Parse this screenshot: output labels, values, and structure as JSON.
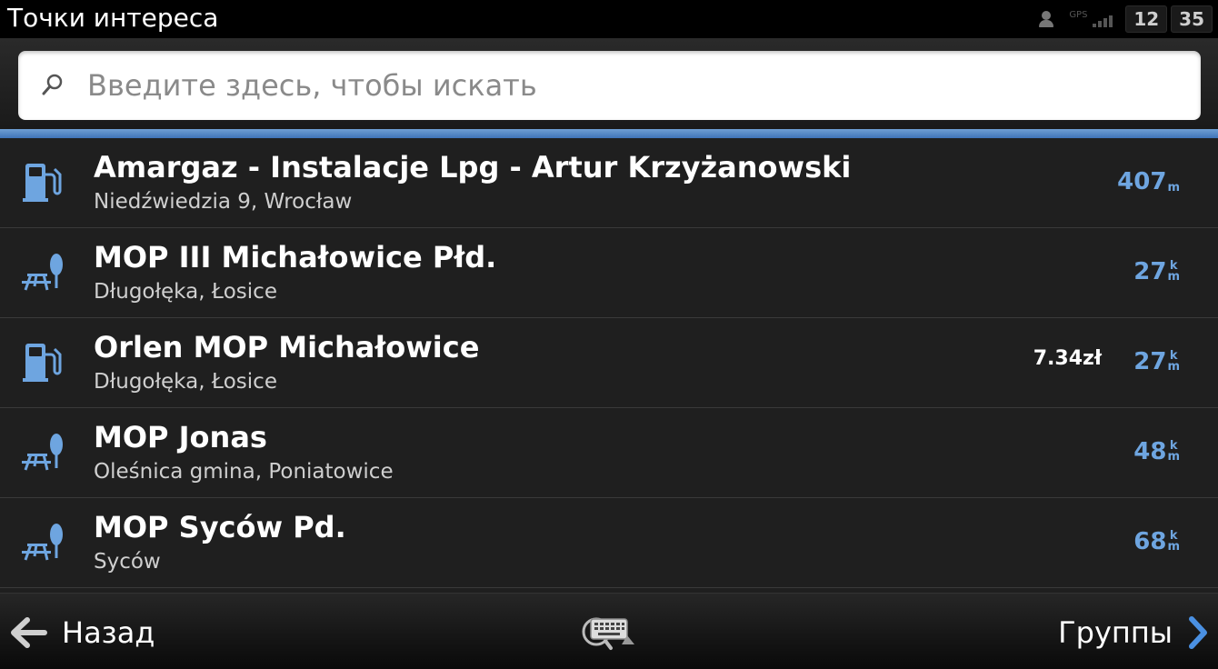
{
  "header": {
    "title": "Точки интереса",
    "gps_label": "GPS",
    "clock_hours": "12",
    "clock_minutes": "35"
  },
  "search": {
    "placeholder": "Введите здесь, чтобы искать"
  },
  "colors": {
    "accent": "#6ea5e0",
    "divider_blue": "#4a82c4"
  },
  "pois": [
    {
      "icon": "fuel-pump-icon",
      "name": "Amargaz - Instalacje Lpg - Artur Krzyżanowski",
      "address": "Niedźwiedzia 9,  Wrocław",
      "price": "",
      "distance": "407",
      "unit_top": "m",
      "unit_bottom": ""
    },
    {
      "icon": "picnic-rest-area-icon",
      "name": "MOP III Michałowice Płd.",
      "address": "Długołęka, Łosice",
      "price": "",
      "distance": "27",
      "unit_top": "k",
      "unit_bottom": "m"
    },
    {
      "icon": "fuel-pump-icon",
      "name": "Orlen MOP Michałowice",
      "address": "Długołęka, Łosice",
      "price": "7.34zł",
      "distance": "27",
      "unit_top": "k",
      "unit_bottom": "m"
    },
    {
      "icon": "picnic-rest-area-icon",
      "name": "MOP Jonas",
      "address": "Oleśnica gmina, Poniatowice",
      "price": "",
      "distance": "48",
      "unit_top": "k",
      "unit_bottom": "m"
    },
    {
      "icon": "picnic-rest-area-icon",
      "name": "MOP Syców Pd.",
      "address": "Syców",
      "price": "",
      "distance": "68",
      "unit_top": "k",
      "unit_bottom": "m"
    }
  ],
  "footer": {
    "back_label": "Назад",
    "back_icon": "arrow-left-icon",
    "keyboard_icon": "keyboard-icon",
    "groups_label": "Группы",
    "groups_icon": "chevron-right-icon"
  }
}
